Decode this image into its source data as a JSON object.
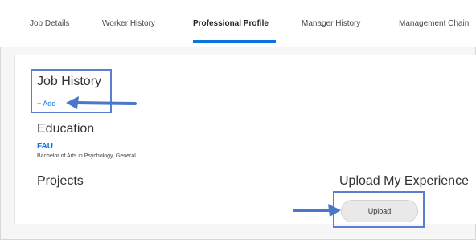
{
  "tabs": [
    {
      "label": "Job Details",
      "active": false
    },
    {
      "label": "Worker History",
      "active": false
    },
    {
      "label": "Professional Profile",
      "active": true
    },
    {
      "label": "Manager History",
      "active": false
    },
    {
      "label": "Management Chain",
      "active": false
    }
  ],
  "sections": {
    "job_history": {
      "title": "Job History",
      "add_label": "+ Add"
    },
    "education": {
      "title": "Education",
      "school": "FAU",
      "degree": "Bachelor of Arts in Psychology, General"
    },
    "projects": {
      "title": "Projects"
    },
    "upload": {
      "title": "Upload My Experience",
      "button_label": "Upload"
    }
  },
  "colors": {
    "accent": "#0875e1",
    "highlight_box": "#5a7fd0",
    "arrow": "#4a78c8"
  }
}
